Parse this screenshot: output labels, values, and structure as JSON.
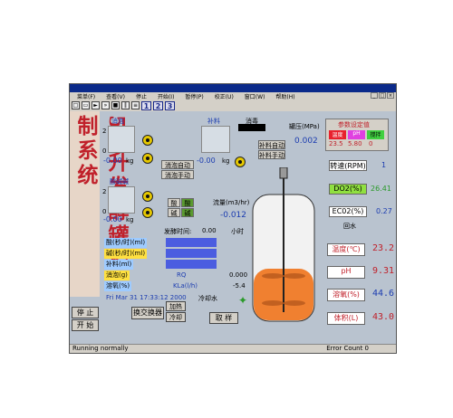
{
  "menu": [
    "菜单(F)",
    "查看(V)",
    "停止",
    "开始(I)",
    "暂停(P)",
    "校正(U)",
    "窗口(W)",
    "帮助(H)"
  ],
  "toolbar_nums": [
    "1",
    "2",
    "3"
  ],
  "vertical_title": "50升发酵罐控制系统",
  "defoam": {
    "title": "消泡",
    "scale_top": "2",
    "scale_bottom": "0",
    "value": "-0.00",
    "unit": "kg",
    "auto": "消泡自动",
    "manual": "消泡手动"
  },
  "acid_base": {
    "title": "酸碱碱",
    "scale_top": "2",
    "scale_bottom": "0",
    "value": "-0.00",
    "unit": "kg",
    "acid": "酸",
    "base": "碱",
    "acid_r": "酸",
    "base_r": "碱"
  },
  "supplement": {
    "title": "补料",
    "value": "-0.00",
    "unit": "kg",
    "auto": "补料自动",
    "manual": "补料手动"
  },
  "sterilize": "消毒",
  "flow": {
    "label": "流量(m3/hr)",
    "value": "-0.012"
  },
  "ferment_time": {
    "label": "发酵时间:",
    "value": "0.00",
    "unit": "小时"
  },
  "pressure": {
    "label": "罐压(MPa)",
    "value": "0.002"
  },
  "param_setting": {
    "title": "参数设定值",
    "items": [
      "温度",
      "pH",
      "搅拌"
    ],
    "values": [
      "23.5",
      "5.80",
      "0"
    ]
  },
  "stats": [
    {
      "label": "酸(秒/时)(ml)",
      "mid": "",
      "value": ""
    },
    {
      "label": "碱(秒/时)(ml)",
      "mid": "",
      "value": ""
    },
    {
      "label": "补料(ml)",
      "mid": "",
      "value": ""
    },
    {
      "label": "消泡(g)",
      "mid": "RQ",
      "value": "0.000"
    },
    {
      "label": "溶氧(%)",
      "mid": "KLa(l/h)",
      "value": "-5.4"
    }
  ],
  "datetime": "Fri Mar 31 17:33:12 2000",
  "heat_exchanger": "换交换器",
  "heat": "加热",
  "cool": "冷却",
  "cooling_water": "冷却水",
  "sample": "取 样",
  "stop": "停 止",
  "start": "开 始",
  "speed": {
    "label": "转速(RPM)",
    "value": "1"
  },
  "do2": {
    "label": "DO2(%)",
    "value": "26.41"
  },
  "co2": {
    "label": "EC02(%)",
    "value": "0.27"
  },
  "return_water": "回水",
  "readings": [
    {
      "label": "温度(℃)",
      "value": "23.2"
    },
    {
      "label": "pH",
      "value": "9.31"
    },
    {
      "label": "溶氧(%)",
      "value": "44.6"
    },
    {
      "label": "体积(L)",
      "value": "43.0"
    }
  ],
  "status_left": "Running normally",
  "status_right": "Error Count 0",
  "colors": {
    "title": "#c0202a",
    "liquid": "#f08030",
    "accent": "#1b3cb0"
  }
}
